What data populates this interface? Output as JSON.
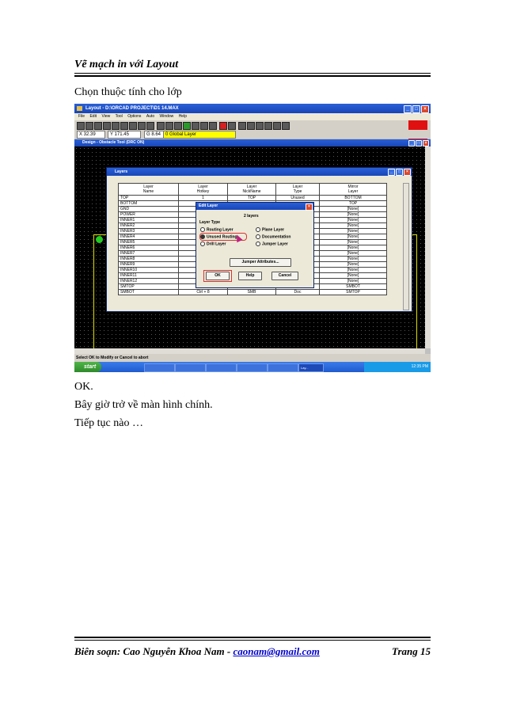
{
  "header": {
    "title": "Vẽ mạch in với Layout"
  },
  "intro": "Chọn thuộc tính cho lớp",
  "screenshot": {
    "window_title": "Layout - D:\\ORCAD PROJECT\\D1 14.MAX",
    "menu": [
      "File",
      "Edit",
      "View",
      "Tool",
      "Options",
      "Auto",
      "Window",
      "Help"
    ],
    "coords": {
      "x": "X 32.39",
      "y": "Y 171.45",
      "g": "G 8.64",
      "layer": "0 Global Layer"
    },
    "design_title": "Design - Obstacle Tool (DRC ON)",
    "layers_window": {
      "title": "Layers",
      "headers": [
        [
          "Layer",
          "Name"
        ],
        [
          "Layer",
          "Hotkey"
        ],
        [
          "Layer",
          "NickName"
        ],
        [
          "Layer",
          "Type"
        ],
        [
          "Mirror",
          "Layer"
        ]
      ],
      "rows": [
        [
          "TOP",
          "1",
          "TOP",
          "Unused",
          "BOTTOM"
        ],
        [
          "BOTTOM",
          "",
          "",
          "",
          "TOP"
        ],
        [
          "GND",
          "",
          "",
          "",
          "[None]"
        ],
        [
          "POWER",
          "",
          "",
          "",
          "[None]"
        ],
        [
          "INNER1",
          "",
          "",
          "",
          "[None]"
        ],
        [
          "INNER2",
          "",
          "",
          "",
          "[None]"
        ],
        [
          "INNER3",
          "",
          "",
          "",
          "[None]"
        ],
        [
          "INNER4",
          "",
          "",
          "",
          "[None]"
        ],
        [
          "INNER5",
          "",
          "",
          "",
          "[None]"
        ],
        [
          "INNER6",
          "",
          "",
          "",
          "[None]"
        ],
        [
          "INNER7",
          "",
          "",
          "",
          "[None]"
        ],
        [
          "INNER8",
          "",
          "",
          "",
          "[None]"
        ],
        [
          "INNER9",
          "",
          "",
          "",
          "[None]"
        ],
        [
          "INNER10",
          "",
          "",
          "",
          "[None]"
        ],
        [
          "INNER11",
          "",
          "",
          "",
          "[None]"
        ],
        [
          "INNER12",
          "Ctrl + 6",
          "I12",
          "Unused",
          "[None]"
        ],
        [
          "SMTOP",
          "Ctrl + 7",
          "SMT",
          "Doc",
          "SMBOT"
        ],
        [
          "SMBOT",
          "Ctrl + 8",
          "SMB",
          "Doc",
          "SMTOP"
        ]
      ]
    },
    "edit_layer": {
      "title": "Edit Layer",
      "layer_name": "2 layers",
      "group_label": "Layer Type",
      "options": {
        "routing": "Routing Layer",
        "plane": "Plane Layer",
        "unused": "Unused Routing",
        "documentation": "Documentation",
        "drill": "Drill Layer",
        "jumper": "Jumper Layer"
      },
      "jumper_button": "Jumper Attributes...",
      "ok": "OK",
      "help": "Help",
      "cancel": "Cancel"
    },
    "status": "Select OK to Modify or Cancel to abort",
    "taskbar": {
      "start": "start",
      "items": [
        "",
        "",
        "",
        "",
        "",
        "Lay..."
      ],
      "clock": "12:35 PM"
    }
  },
  "after": {
    "line1": "OK.",
    "line2": "Bây giờ trở về màn hình chính.",
    "line3": "Tiếp tục nào …"
  },
  "footer": {
    "author_prefix": "Biên soạn: Cao Nguyễn Khoa Nam - ",
    "email": "caonam@gmail.com",
    "page": "Trang 15"
  }
}
